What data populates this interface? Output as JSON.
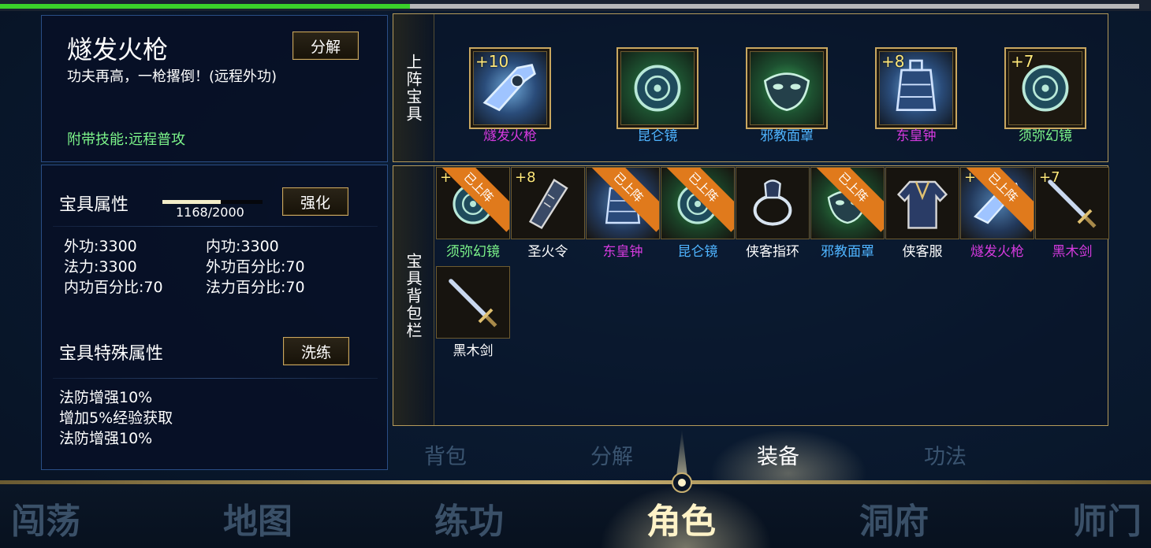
{
  "top_progress": {
    "fraction": 0.36
  },
  "item_detail": {
    "name": "燧发火枪",
    "description": "功夫再高，一枪撂倒！(远程外功)",
    "skill": "附带技能:远程普攻",
    "decompose_label": "分解"
  },
  "stats": {
    "title": "宝具属性",
    "exp_text": "1168/2000",
    "exp_current": 1168,
    "exp_max": 2000,
    "strengthen_label": "强化",
    "attributes": [
      "外功:3300",
      "内功:3300",
      "法力:3300",
      "外功百分比:70",
      "内功百分比:70",
      "法力百分比:70"
    ],
    "special_title": "宝具特殊属性",
    "refine_label": "洗练",
    "special_attributes": [
      "法防增强10%",
      "增加5%经验获取",
      "法防增强10%"
    ]
  },
  "equipped": {
    "side_label": "上阵宝具",
    "items": [
      {
        "name": "燧发火枪",
        "enhance": "+10",
        "name_color": "#d63adf",
        "glow": "blue",
        "icon": "flintlock-gun-icon"
      },
      {
        "name": "昆仑镜",
        "enhance": "",
        "name_color": "#4fb4ff",
        "glow": "green",
        "icon": "mirror-icon"
      },
      {
        "name": "邪教面罩",
        "enhance": "",
        "name_color": "#4fb4ff",
        "glow": "green",
        "icon": "mask-icon"
      },
      {
        "name": "东皇钟",
        "enhance": "+8",
        "name_color": "#d63adf",
        "glow": "blue",
        "icon": "bell-icon"
      },
      {
        "name": "须弥幻镜",
        "enhance": "+7",
        "name_color": "#7cf58a",
        "glow": "none",
        "icon": "mirror-icon"
      }
    ]
  },
  "bag": {
    "side_label": "宝具背包栏",
    "equipped_ribbon": "已上阵",
    "items": [
      {
        "name": "须弥幻镜",
        "enhance": "+",
        "name_color": "#7cf58a",
        "equipped": true,
        "glow": "none",
        "icon": "mirror-icon"
      },
      {
        "name": "圣火令",
        "enhance": "+8",
        "name_color": "#ffffff",
        "equipped": false,
        "glow": "none",
        "icon": "token-icon"
      },
      {
        "name": "东皇钟",
        "enhance": "",
        "name_color": "#d63adf",
        "equipped": true,
        "glow": "blue",
        "icon": "bell-icon"
      },
      {
        "name": "昆仑镜",
        "enhance": "",
        "name_color": "#4fb4ff",
        "equipped": true,
        "glow": "green",
        "icon": "mirror-icon"
      },
      {
        "name": "侠客指环",
        "enhance": "",
        "name_color": "#ffffff",
        "equipped": false,
        "glow": "none",
        "icon": "ring-icon"
      },
      {
        "name": "邪教面罩",
        "enhance": "",
        "name_color": "#4fb4ff",
        "equipped": true,
        "glow": "green",
        "icon": "mask-icon"
      },
      {
        "name": "侠客服",
        "enhance": "",
        "name_color": "#ffffff",
        "equipped": false,
        "glow": "none",
        "icon": "robe-icon"
      },
      {
        "name": "燧发火枪",
        "enhance": "+",
        "name_color": "#d63adf",
        "equipped": true,
        "glow": "blue",
        "icon": "flintlock-gun-icon"
      },
      {
        "name": "黑木剑",
        "enhance": "+7",
        "name_color": "#d63adf",
        "equipped": false,
        "glow": "none",
        "icon": "sword-icon"
      },
      {
        "name": "黑木剑",
        "enhance": "",
        "name_color": "#ffffff",
        "equipped": false,
        "glow": "none",
        "icon": "sword-icon"
      }
    ]
  },
  "sub_tabs": [
    {
      "label": "背包",
      "active": false
    },
    {
      "label": "分解",
      "active": false
    },
    {
      "label": "装备",
      "active": true
    },
    {
      "label": "功法",
      "active": false
    }
  ],
  "nav": [
    {
      "label": "闯荡",
      "active": false
    },
    {
      "label": "地图",
      "active": false
    },
    {
      "label": "练功",
      "active": false
    },
    {
      "label": "角色",
      "active": true
    },
    {
      "label": "洞府",
      "active": false
    },
    {
      "label": "师门",
      "active": false
    }
  ]
}
